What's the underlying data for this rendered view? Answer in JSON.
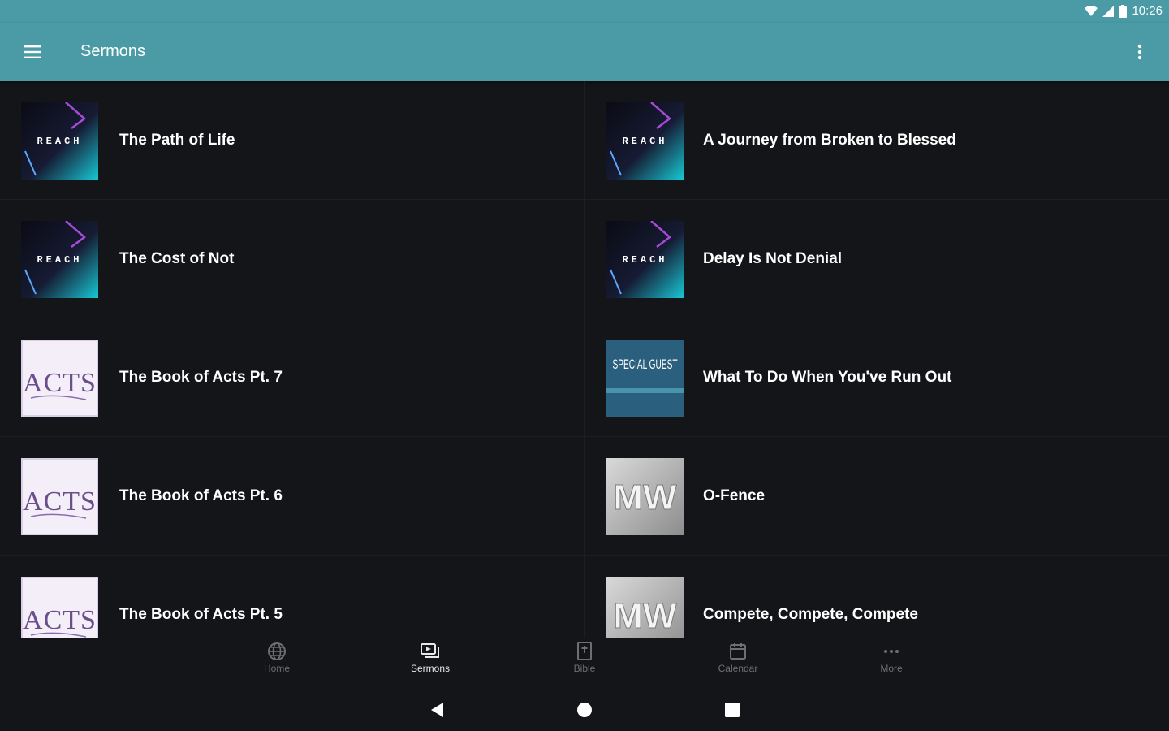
{
  "status": {
    "time": "10:26"
  },
  "appbar": {
    "title": "Sermons"
  },
  "sermons": [
    {
      "title": "The Path of Life",
      "art": "reach-art",
      "art_text": "REACH"
    },
    {
      "title": "A Journey from Broken to Blessed",
      "art": "reach-art",
      "art_text": "REACH"
    },
    {
      "title": "The Cost of Not",
      "art": "reach-art",
      "art_text": "REACH"
    },
    {
      "title": "Delay Is Not Denial",
      "art": "reach-art",
      "art_text": "REACH"
    },
    {
      "title": "The Book of Acts Pt. 7",
      "art": "acts-art",
      "art_text": "ACTS"
    },
    {
      "title": "What To Do When You've Run Out",
      "art": "special-guest-art",
      "art_text": "SPECIAL GUEST"
    },
    {
      "title": "The Book of Acts Pt. 6",
      "art": "acts-art",
      "art_text": "ACTS"
    },
    {
      "title": "O-Fence",
      "art": "mw-art",
      "art_text": "MW"
    },
    {
      "title": "The Book of Acts Pt. 5",
      "art": "acts-art",
      "art_text": "ACTS"
    },
    {
      "title": "Compete, Compete, Compete",
      "art": "mw-art",
      "art_text": "MW"
    }
  ],
  "bottom_nav": [
    {
      "label": "Home",
      "icon": "globe-icon",
      "active": false
    },
    {
      "label": "Sermons",
      "icon": "sermons-icon",
      "active": true
    },
    {
      "label": "Bible",
      "icon": "bible-icon",
      "active": false
    },
    {
      "label": "Calendar",
      "icon": "calendar-icon",
      "active": false
    },
    {
      "label": "More",
      "icon": "more-dots-icon",
      "active": false
    }
  ],
  "colors": {
    "accent": "#4a9ba6",
    "background": "#141518",
    "active_nav": "#e8e8e8",
    "inactive_nav": "#6e6f73"
  }
}
